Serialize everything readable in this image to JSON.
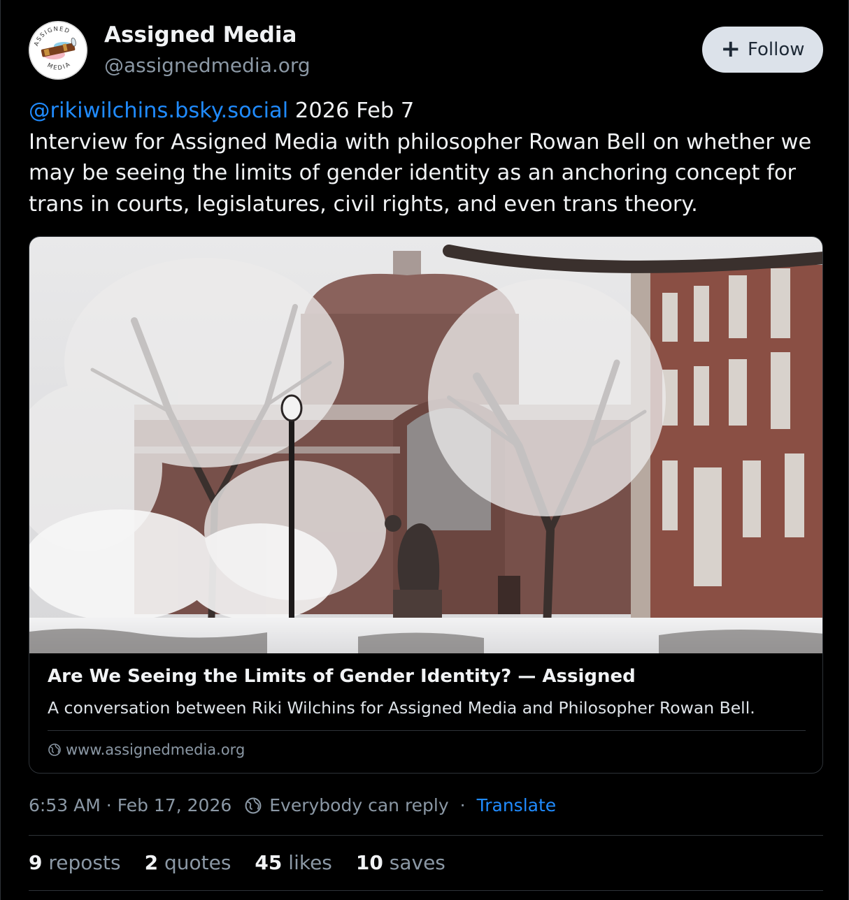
{
  "author": {
    "display_name": "Assigned Media",
    "handle": "@assignedmedia.org",
    "avatar_icon": "spyglass-logo-icon",
    "avatar_logo_text_top": "ASSIGNED",
    "avatar_logo_text_bottom": "MEDIA"
  },
  "follow_button": {
    "label": "Follow",
    "icon": "plus-icon"
  },
  "post": {
    "mention": "@rikiwilchins.bsky.social",
    "text": " 2026 Feb 7\nInterview for Assigned Media with philosopher Rowan Bell on whether we may be seeing the limits of gender identity as an anchoring concept for trans in courts, legislatures, civil rights, and even trans theory."
  },
  "link_card": {
    "title": "Are We Seeing the Limits of Gender Identity? — Assigned",
    "description": "A conversation between Riki Wilchins for Assigned Media and Philosopher Rowan Bell.",
    "domain": "www.assignedmedia.org",
    "domain_icon": "globe-icon"
  },
  "meta": {
    "time": "6:53 AM",
    "separator": "·",
    "date": "Feb 17, 2026",
    "reply_setting": "Everybody can reply",
    "reply_icon": "globe-icon",
    "translate": "Translate"
  },
  "stats": {
    "reposts_count": "9",
    "reposts_label": "reposts",
    "quotes_count": "2",
    "quotes_label": "quotes",
    "likes_count": "45",
    "likes_label": "likes",
    "saves_count": "10",
    "saves_label": "saves"
  },
  "colors": {
    "background": "#000000",
    "link_blue": "#208bfe",
    "muted_text": "#8b98a5",
    "follow_bg": "#dce2ea",
    "border": "#2e3338"
  }
}
